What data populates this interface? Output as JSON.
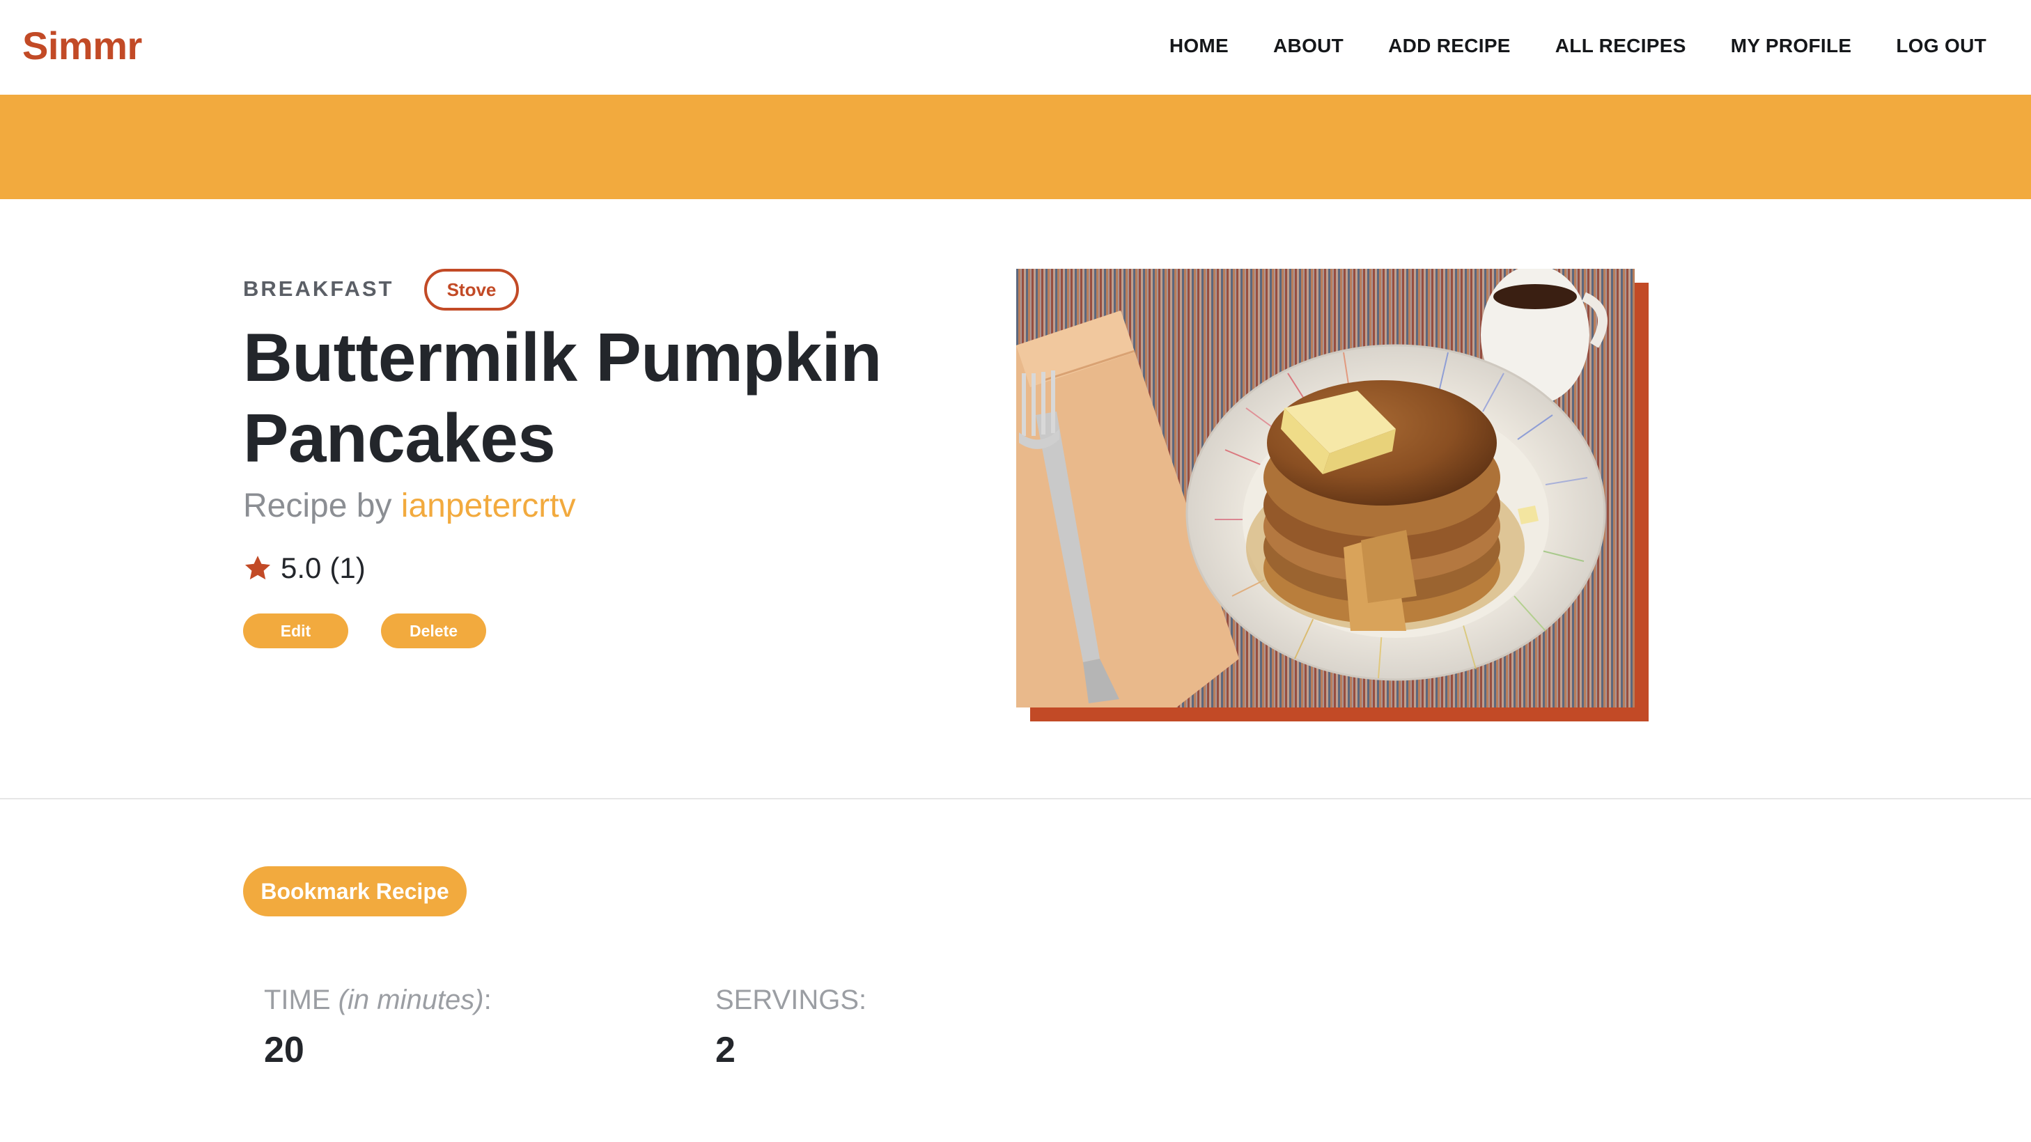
{
  "app": {
    "logo": "Simmr"
  },
  "nav": {
    "items": [
      {
        "label": "HOME"
      },
      {
        "label": "ABOUT"
      },
      {
        "label": "ADD RECIPE"
      },
      {
        "label": "ALL RECIPES"
      },
      {
        "label": "MY PROFILE"
      },
      {
        "label": "LOG OUT"
      }
    ]
  },
  "recipe": {
    "category": "BREAKFAST",
    "method": "Stove",
    "title": "Buttermilk Pumpkin Pancakes",
    "byline_prefix": "Recipe by ",
    "author": "ianpetercrtv",
    "rating_value": "5.0",
    "rating_count": "(1)",
    "edit_label": "Edit",
    "delete_label": "Delete",
    "bookmark_label": "Bookmark Recipe",
    "image_alt": "Stack of pumpkin pancakes with butter and syrup on a plate"
  },
  "stats": {
    "time_label_main": "TIME ",
    "time_label_unit": "(in minutes)",
    "time_label_colon": ":",
    "time_value": "20",
    "servings_label": "SERVINGS:",
    "servings_value": "2"
  },
  "colors": {
    "brand": "#c24a26",
    "accent": "#f2aa3e",
    "text": "#23262b",
    "muted": "#8b8e93"
  },
  "icons": {
    "rating": "star-icon"
  }
}
